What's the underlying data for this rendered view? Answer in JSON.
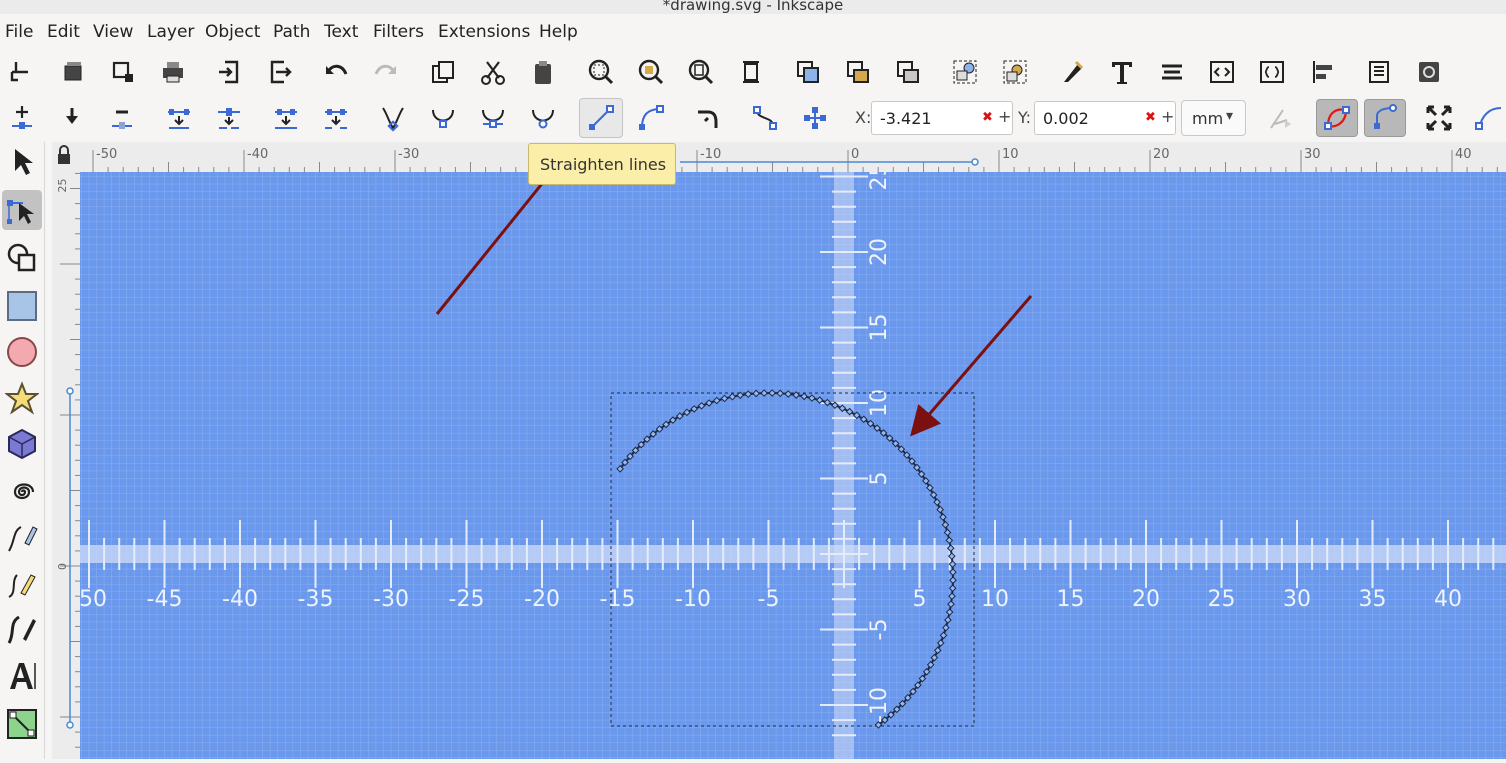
{
  "window": {
    "title": "*drawing.svg - Inkscape"
  },
  "menu": [
    "File",
    "Edit",
    "View",
    "Layer",
    "Object",
    "Path",
    "Text",
    "Filters",
    "Extensions",
    "Help"
  ],
  "commands": [
    "new-document",
    "open",
    "save",
    "print",
    "import",
    "export",
    "undo",
    "redo",
    "copy",
    "cut",
    "paste",
    "zoom-selection",
    "zoom-drawing",
    "zoom-page",
    "zoom-page-width",
    "duplicate",
    "clone",
    "unlink-clone",
    "group",
    "ungroup",
    "fill-and-stroke",
    "text-and-font",
    "transform",
    "xml-editor",
    "objects",
    "align-distribute",
    "document-properties",
    "preferences"
  ],
  "node_toolbar": {
    "buttons": [
      "insert-node",
      "insert-node-min-x",
      "delete-node",
      "join-nodes",
      "break-path",
      "join-segment",
      "delete-segment",
      "make-cusp",
      "make-smooth",
      "make-symmetric",
      "make-auto-smooth",
      "straighten-lines",
      "make-curves",
      "add-corner",
      "object-to-path",
      "stroke-to-path"
    ],
    "x_label": "X:",
    "x_value": "-3.421",
    "y_label": "Y:",
    "y_value": "0.002",
    "unit": "mm",
    "remove_glyph": "✖",
    "add_glyph": "+",
    "dropdown_glyph": "▾"
  },
  "tooltip": "Straighten lines",
  "tools": [
    "selector",
    "node",
    "shape-builder",
    "rectangle",
    "ellipse",
    "star",
    "3d-box",
    "spiral",
    "pencil",
    "pen",
    "calligraphy",
    "text",
    "gradient"
  ],
  "ruler": {
    "top_labels": [
      "-50",
      "-40",
      "-30",
      "-20",
      "-10",
      "0",
      "10",
      "20",
      "30",
      "40"
    ],
    "left_labels": [
      "25",
      "0"
    ]
  },
  "canvas_grid": {
    "x_labels": [
      "-50",
      "-45",
      "-40",
      "-35",
      "-30",
      "-25",
      "-20",
      "-15",
      "-10",
      "-5",
      "5",
      "10",
      "15",
      "20",
      "25",
      "30",
      "35",
      "40"
    ],
    "y_labels": [
      "25",
      "20",
      "15",
      "10",
      "5",
      "-5",
      "-10"
    ]
  },
  "colors": {
    "canvas": "#6a98ec",
    "arrow": "#7a1010",
    "path": "#1c2a4a",
    "tooltip": "#fbeea8"
  }
}
